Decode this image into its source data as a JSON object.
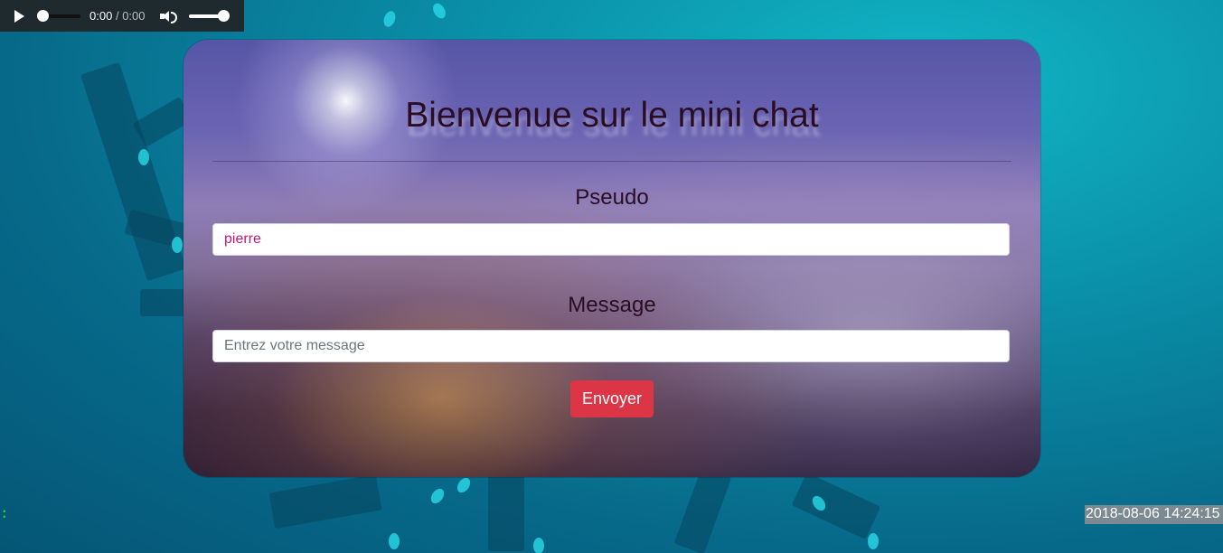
{
  "audio_player": {
    "current_time": "0:00",
    "separator": "/",
    "duration": "0:00",
    "icons": [
      "play-icon",
      "volume-icon"
    ]
  },
  "chat": {
    "title": "Bienvenue sur le mini chat",
    "pseudo_label": "Pseudo",
    "pseudo_value": "pierre",
    "message_label": "Message",
    "message_placeholder": "Entrez votre message",
    "submit_label": "Envoyer",
    "submit_color": "#dc3545"
  },
  "footer": {
    "indicator": ":",
    "timestamp": "2018-08-06 14:24:15"
  }
}
